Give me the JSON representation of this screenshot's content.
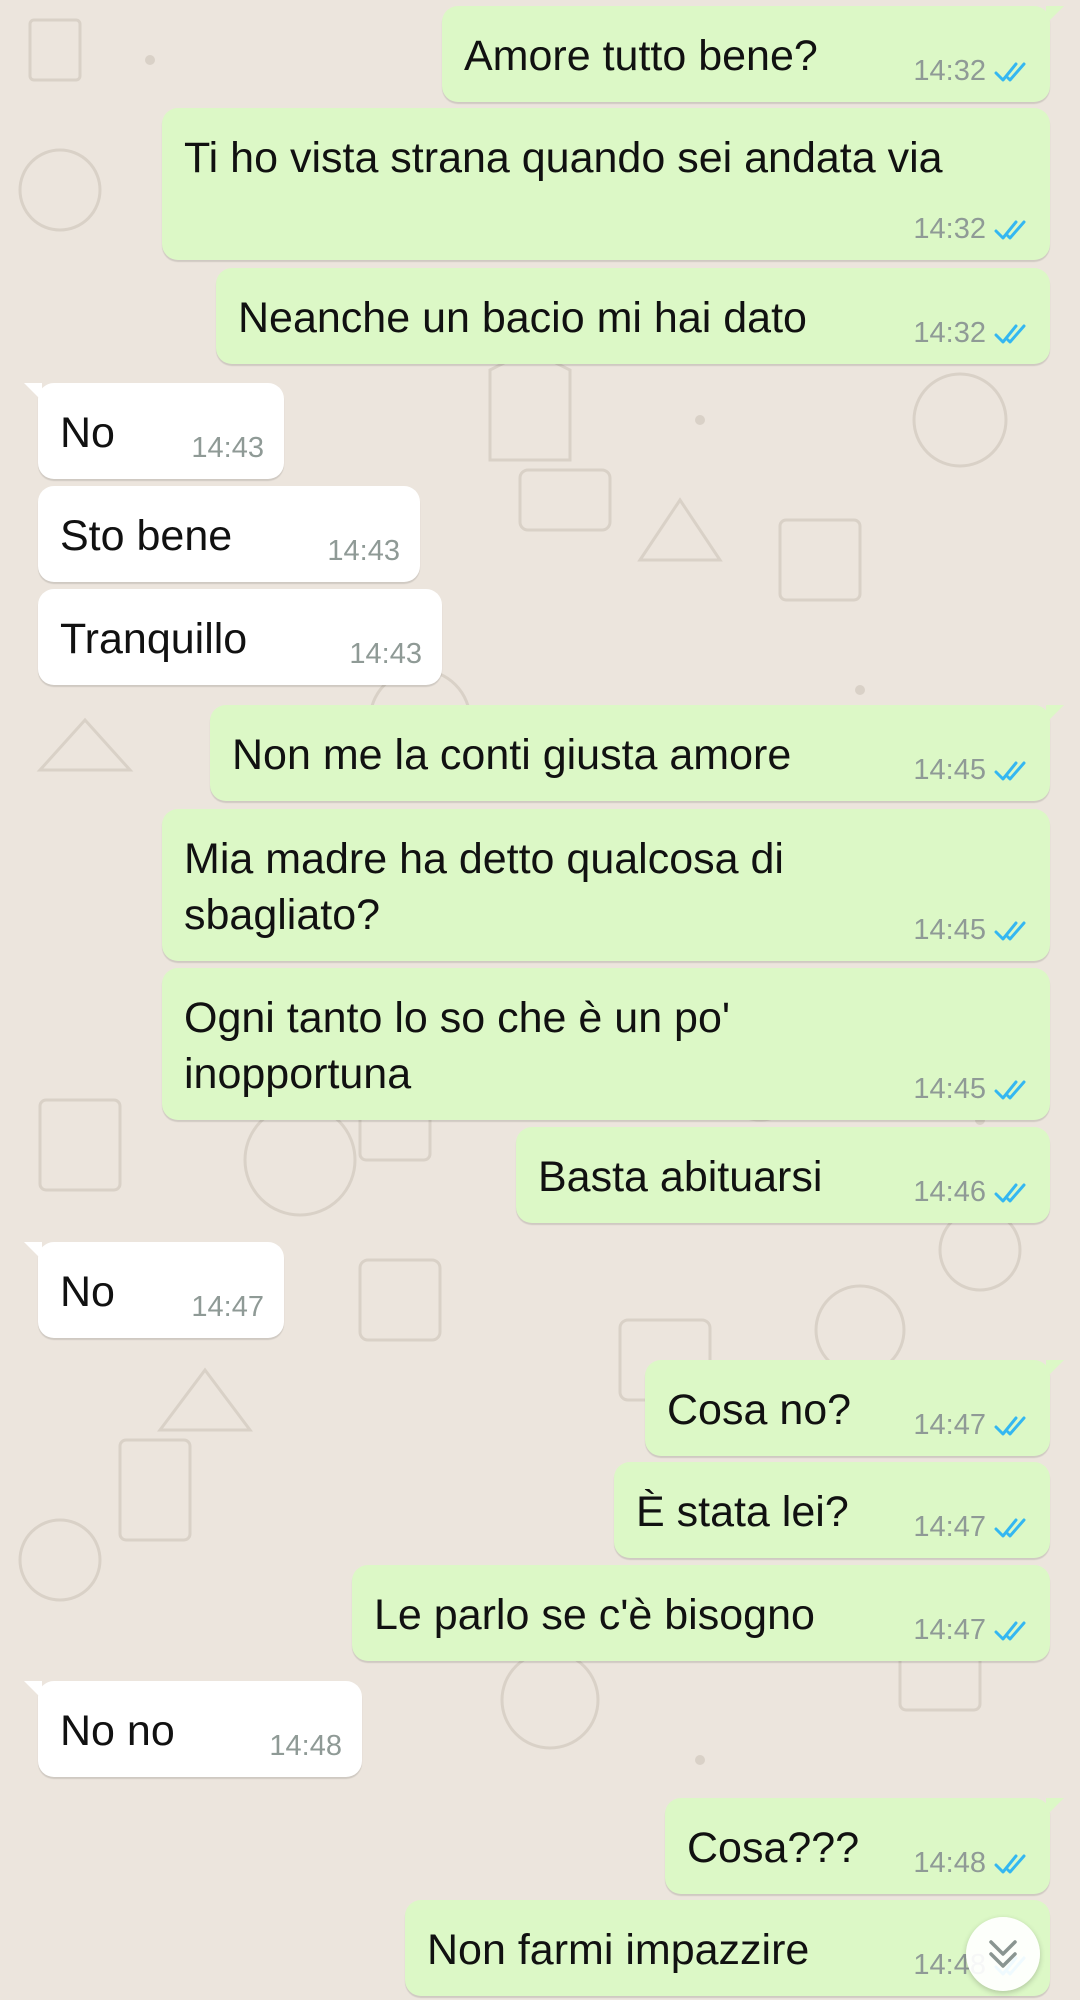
{
  "colors": {
    "background": "#ece5dd",
    "outgoing_bubble": "#dcf8c6",
    "incoming_bubble": "#ffffff",
    "read_ticks": "#34b7f1",
    "timestamp": "#8f9a96"
  },
  "icons": {
    "read_receipt": "double-check-icon",
    "scroll_down": "chevron-double-down-icon"
  },
  "messages": [
    {
      "dir": "out",
      "text": "Amore tutto bene?",
      "time": "14:32",
      "status": "read"
    },
    {
      "dir": "out",
      "text": "Ti ho vista strana quando sei andata via",
      "time": "14:32",
      "status": "read"
    },
    {
      "dir": "out",
      "text": "Neanche un bacio mi hai dato",
      "time": "14:32",
      "status": "read"
    },
    {
      "dir": "in",
      "text": "No",
      "time": "14:43"
    },
    {
      "dir": "in",
      "text": "Sto bene",
      "time": "14:43"
    },
    {
      "dir": "in",
      "text": "Tranquillo",
      "time": "14:43"
    },
    {
      "dir": "out",
      "text": "Non me la conti giusta amore",
      "time": "14:45",
      "status": "read"
    },
    {
      "dir": "out",
      "text": "Mia madre ha detto qualcosa di\nsbagliato?",
      "time": "14:45",
      "status": "read"
    },
    {
      "dir": "out",
      "text": "Ogni tanto lo so che è un po'\ninopportuna",
      "time": "14:45",
      "status": "read"
    },
    {
      "dir": "out",
      "text": "Basta abituarsi",
      "time": "14:46",
      "status": "read"
    },
    {
      "dir": "in",
      "text": "No",
      "time": "14:47"
    },
    {
      "dir": "out",
      "text": "Cosa no?",
      "time": "14:47",
      "status": "read"
    },
    {
      "dir": "out",
      "text": "È stata lei?",
      "time": "14:47",
      "status": "read"
    },
    {
      "dir": "out",
      "text": "Le parlo se c'è bisogno",
      "time": "14:47",
      "status": "read"
    },
    {
      "dir": "in",
      "text": "No no",
      "time": "14:48"
    },
    {
      "dir": "out",
      "text": "Cosa???",
      "time": "14:48",
      "status": "read"
    },
    {
      "dir": "out",
      "text": "Non farmi impazzire",
      "time": "14:48",
      "status": "read"
    }
  ]
}
